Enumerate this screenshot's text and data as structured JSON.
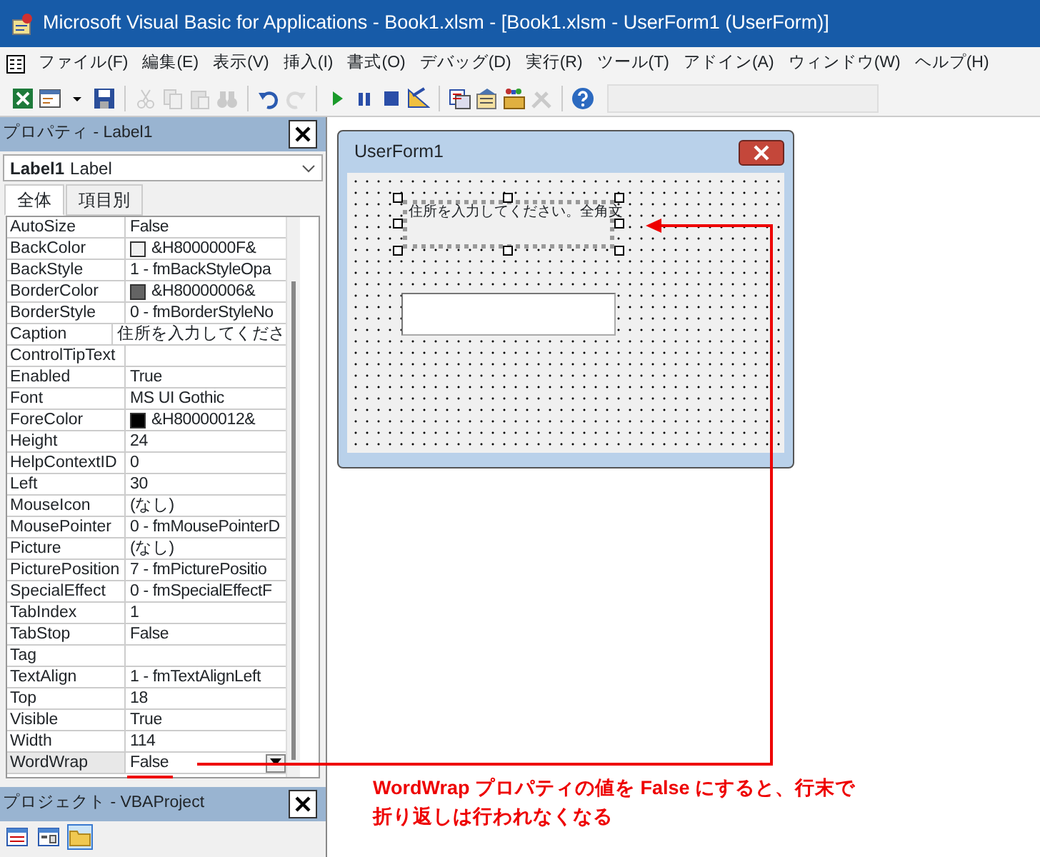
{
  "window": {
    "title": "Microsoft Visual Basic for Applications - Book1.xlsm - [Book1.xlsm - UserForm1 (UserForm)]"
  },
  "menu": [
    "ファイル(F)",
    "編集(E)",
    "表示(V)",
    "挿入(I)",
    "書式(O)",
    "デバッグ(D)",
    "実行(R)",
    "ツール(T)",
    "アドイン(A)",
    "ウィンドウ(W)",
    "ヘルプ(H)"
  ],
  "toolbar": [
    {
      "kind": "excel",
      "disabled": false
    },
    {
      "kind": "form",
      "disabled": false
    },
    {
      "kind": "caret",
      "disabled": false
    },
    {
      "kind": "save",
      "disabled": false
    },
    {
      "kind": "sep"
    },
    {
      "kind": "cut",
      "disabled": true
    },
    {
      "kind": "copy",
      "disabled": true
    },
    {
      "kind": "paste",
      "disabled": true
    },
    {
      "kind": "find",
      "disabled": true
    },
    {
      "kind": "sep"
    },
    {
      "kind": "undo",
      "disabled": false
    },
    {
      "kind": "redo",
      "disabled": true
    },
    {
      "kind": "sep"
    },
    {
      "kind": "run",
      "disabled": false
    },
    {
      "kind": "pause",
      "disabled": false
    },
    {
      "kind": "stop",
      "disabled": false
    },
    {
      "kind": "design",
      "disabled": false
    },
    {
      "kind": "sep"
    },
    {
      "kind": "project",
      "disabled": false
    },
    {
      "kind": "properties",
      "disabled": false
    },
    {
      "kind": "toolbox",
      "disabled": false
    },
    {
      "kind": "tools",
      "disabled": true
    },
    {
      "kind": "sep"
    },
    {
      "kind": "help",
      "disabled": false
    }
  ],
  "properties_panel": {
    "title": "プロパティ - Label1",
    "object_name": "Label1",
    "object_type": "Label",
    "tabs": [
      {
        "label": "全体",
        "selected": true
      },
      {
        "label": "項目別",
        "selected": false
      }
    ],
    "rows": [
      {
        "name": "AutoSize",
        "value": "False",
        "kind": "text",
        "selected": false
      },
      {
        "name": "BackColor",
        "value": "&H8000000F&",
        "kind": "color",
        "color": "#f0f0f0",
        "selected": false
      },
      {
        "name": "BackStyle",
        "value": "1 - fmBackStyleOpa",
        "kind": "text",
        "selected": false
      },
      {
        "name": "BorderColor",
        "value": "&H80000006&",
        "kind": "color",
        "color": "#646464",
        "selected": false
      },
      {
        "name": "BorderStyle",
        "value": "0 - fmBorderStyleNo",
        "kind": "text",
        "selected": false
      },
      {
        "name": "Caption",
        "value": "住所を入力してくださ",
        "kind": "text",
        "selected": false
      },
      {
        "name": "ControlTipText",
        "value": "",
        "kind": "text",
        "selected": false
      },
      {
        "name": "Enabled",
        "value": "True",
        "kind": "text",
        "selected": false
      },
      {
        "name": "Font",
        "value": "MS UI Gothic",
        "kind": "text",
        "selected": false
      },
      {
        "name": "ForeColor",
        "value": "&H80000012&",
        "kind": "color",
        "color": "#000000",
        "selected": false
      },
      {
        "name": "Height",
        "value": "24",
        "kind": "text",
        "selected": false
      },
      {
        "name": "HelpContextID",
        "value": "0",
        "kind": "text",
        "selected": false
      },
      {
        "name": "Left",
        "value": "30",
        "kind": "text",
        "selected": false
      },
      {
        "name": "MouseIcon",
        "value": "(なし)",
        "kind": "text",
        "selected": false
      },
      {
        "name": "MousePointer",
        "value": "0 - fmMousePointerD",
        "kind": "text",
        "selected": false
      },
      {
        "name": "Picture",
        "value": "(なし)",
        "kind": "text",
        "selected": false
      },
      {
        "name": "PicturePosition",
        "value": "7 - fmPicturePositio",
        "kind": "text",
        "selected": false
      },
      {
        "name": "SpecialEffect",
        "value": "0 - fmSpecialEffectF",
        "kind": "text",
        "selected": false
      },
      {
        "name": "TabIndex",
        "value": "1",
        "kind": "text",
        "selected": false
      },
      {
        "name": "TabStop",
        "value": "False",
        "kind": "text",
        "selected": false
      },
      {
        "name": "Tag",
        "value": "",
        "kind": "text",
        "selected": false
      },
      {
        "name": "TextAlign",
        "value": "1 - fmTextAlignLeft",
        "kind": "text",
        "selected": false
      },
      {
        "name": "Top",
        "value": "18",
        "kind": "text",
        "selected": false
      },
      {
        "name": "Visible",
        "value": "True",
        "kind": "text",
        "selected": false
      },
      {
        "name": "Width",
        "value": "114",
        "kind": "text",
        "selected": false
      },
      {
        "name": "WordWrap",
        "value": "False",
        "kind": "text",
        "selected": true
      }
    ]
  },
  "project_panel": {
    "title": "プロジェクト - VBAProject",
    "buttons": [
      {
        "kind": "code",
        "selected": false
      },
      {
        "kind": "object",
        "selected": false
      },
      {
        "kind": "folder",
        "selected": true
      }
    ]
  },
  "userform": {
    "title": "UserForm1",
    "label_caption": "住所を入力してください。全角文"
  },
  "annotation": "WordWrap プロパティの値を False にすると、行末で折り返しは行われなくなる"
}
